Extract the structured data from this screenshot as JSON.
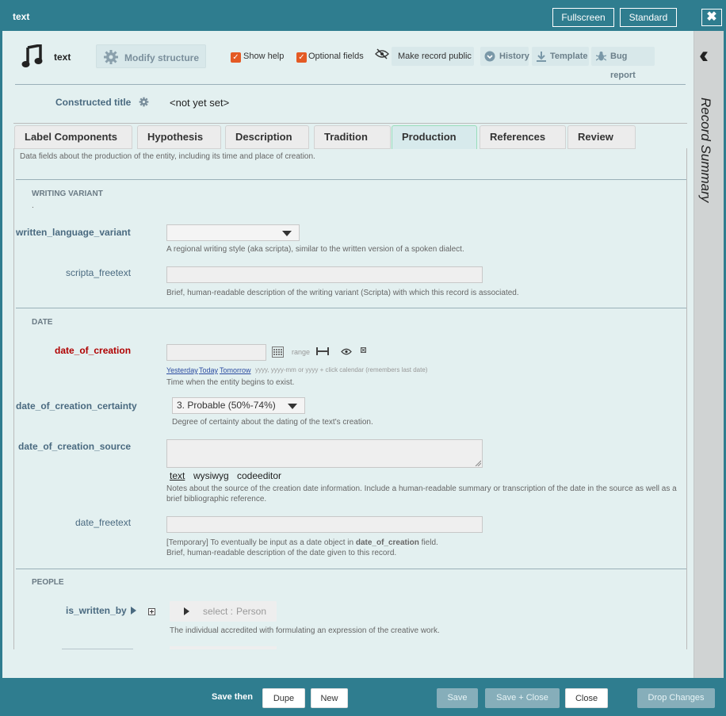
{
  "window": {
    "title": "text",
    "fullscreen_label": "Fullscreen",
    "standard_label": "Standard",
    "close_glyph": "✖"
  },
  "header": {
    "record_type": "text",
    "modify_structure": "Modify structure",
    "show_help": "Show help",
    "optional_fields": "Optional fields",
    "make_public": "Make record public",
    "history": "History",
    "template": "Template",
    "bug_report": "Bug report"
  },
  "constructed_title": {
    "label": "Constructed title",
    "value": "<not yet set>"
  },
  "tabs": [
    {
      "label": "Label Components"
    },
    {
      "label": "Hypothesis"
    },
    {
      "label": "Description"
    },
    {
      "label": "Tradition"
    },
    {
      "label": "Production"
    },
    {
      "label": "References"
    },
    {
      "label": "Review"
    }
  ],
  "production": {
    "intro": "Data fields about the production of the entity, including its time and place of creation.",
    "writing_variant": {
      "heading": "WRITING VARIANT",
      "dot": ".",
      "written_language_variant": {
        "label": "written_language_variant",
        "help": "A regional writing style (aka scripta), similar to the written version of a spoken dialect."
      },
      "scripta_freetext": {
        "label": "scripta_freetext",
        "help": "Brief, human-readable description of the writing variant (Scripta) with which this record is associated."
      }
    },
    "date": {
      "heading": "DATE",
      "date_of_creation": {
        "label": "date_of_creation",
        "range": "range",
        "yesterday": "Yesterday",
        "today": "Today",
        "tomorrow": "Tomorrow",
        "format_hint": "yyyy, yyyy-mm or yyyy + click calendar (remembers last date)",
        "help": "Time when the entity begins to exist."
      },
      "certainty": {
        "label": "date_of_creation_certainty",
        "value": "3. Probable (50%-74%)",
        "help": "Degree of certainty about the dating of the text's creation."
      },
      "source": {
        "label": "date_of_creation_source",
        "mode_text": "text",
        "mode_wysiwyg": "wysiwyg",
        "mode_codeeditor": "codeeditor",
        "help1": "Notes about the source of the creation date information. Include a human-readable summary or transcription of the date in the source as well as a",
        "help2": "brief bibliographic reference."
      },
      "date_freetext": {
        "label": "date_freetext",
        "help1a": "[Temporary] To eventually be input as a date object in",
        "help1b": "date_of_creation",
        "help1c": "field.",
        "help2": "Brief, human-readable description of the date given to this record."
      }
    },
    "people": {
      "heading": "PEOPLE",
      "is_written_by": {
        "label": "is_written_by",
        "select_prefix": "select :",
        "select_type": "Person",
        "help": "The individual accredited with formulating an expression of the creative work."
      }
    }
  },
  "footer": {
    "save_then": "Save then",
    "dupe": "Dupe",
    "new": "New",
    "save": "Save",
    "save_close": "Save + Close",
    "close": "Close",
    "drop": "Drop Changes"
  }
}
